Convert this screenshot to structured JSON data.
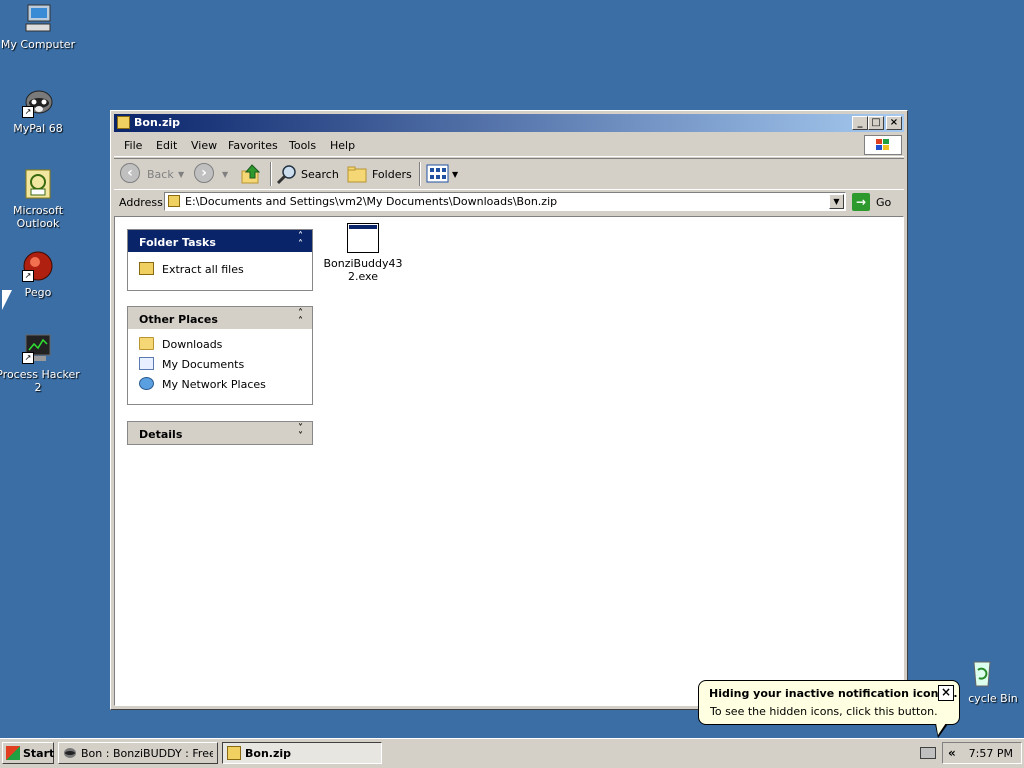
{
  "desktop": {
    "icons": [
      {
        "label": "My Computer",
        "icon": "computer-icon"
      },
      {
        "label": "MyPal 68",
        "icon": "raccoon-icon"
      },
      {
        "label": "Microsoft Outlook",
        "icon": "outlook-icon"
      },
      {
        "label": "Pego",
        "icon": "pego-icon"
      },
      {
        "label": "Process Hacker 2",
        "icon": "process-hacker-icon"
      },
      {
        "label": "cycle Bin",
        "icon": "recycle-bin-icon"
      }
    ]
  },
  "window": {
    "title": "Bon.zip",
    "menu": [
      "File",
      "Edit",
      "View",
      "Favorites",
      "Tools",
      "Help"
    ],
    "toolbar": {
      "back": "Back",
      "search": "Search",
      "folders": "Folders"
    },
    "address": {
      "label": "Address",
      "value": "E:\\Documents and Settings\\vm2\\My Documents\\Downloads\\Bon.zip",
      "go": "Go"
    },
    "folder_tasks": {
      "title": "Folder Tasks",
      "items": [
        "Extract all files"
      ]
    },
    "other_places": {
      "title": "Other Places",
      "items": [
        "Downloads",
        "My Documents",
        "My Network Places"
      ]
    },
    "details": {
      "title": "Details"
    },
    "files": [
      {
        "name": "BonziBuddy432.exe"
      }
    ]
  },
  "taskbar": {
    "start": "Start",
    "tasks": [
      {
        "label": "Bon : BonziBUDDY : Free...",
        "active": false
      },
      {
        "label": "Bon.zip",
        "active": true
      }
    ],
    "time": "7:57 PM",
    "chevron": "«"
  },
  "balloon": {
    "title": "Hiding your inactive notification icons...",
    "body": "To see the hidden icons, click this button."
  }
}
